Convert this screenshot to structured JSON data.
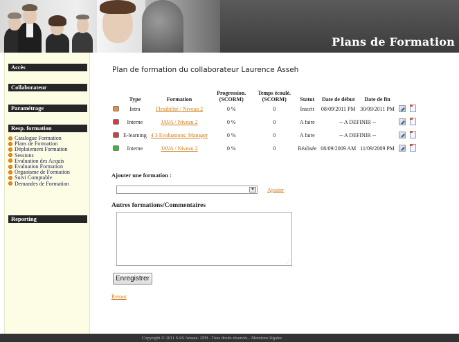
{
  "header": {
    "title": "Plans de Formation"
  },
  "sidebar": {
    "sections": {
      "acces": "Accès",
      "collaborateur": "Collaborateur",
      "parametrage": "Paramétrage",
      "resp_formation": "Resp. formation",
      "reporting": "Reporting"
    },
    "items": [
      "Catalogue Formation",
      "Plans de Formation",
      "Déploiement Formation",
      "Sessions",
      "Evaluation des Acquis",
      "Evaluation Formation",
      "Organisme de Formation",
      "Suivi Comptable",
      "Demandes de Formation"
    ]
  },
  "main": {
    "title": "Plan de formation du collaborateur Laurence Asseh",
    "columns": {
      "type": "Type",
      "formation": "Formation",
      "progression": "Progression. (SCORM)",
      "temps": "Temps écoulé. (SCORM)",
      "statut": "Statut",
      "date_debut": "Date de début",
      "date_fin": "Date de fin"
    },
    "rows": [
      {
        "color": "#e8903a",
        "type": "Intra",
        "formation": "Flexibilité / Niveau 2",
        "progression": "0 %",
        "temps": "0",
        "statut": "Inscrit",
        "date_debut": "08/09/2011 PM",
        "date_fin": "30/09/2011 PM",
        "to_define": ""
      },
      {
        "color": "#d83a3a",
        "type": "Interne",
        "formation": "JAVA / Niveau 2",
        "progression": "0 %",
        "temps": "0",
        "statut": "A faire",
        "date_debut": "",
        "date_fin": "",
        "to_define": "-- A DEFINIR --"
      },
      {
        "color": "#d83a3a",
        "type": "E-learning",
        "formation": "4 3 Evaluations: Manager",
        "progression": "0 %",
        "temps": "0",
        "statut": "A faire",
        "date_debut": "",
        "date_fin": "",
        "to_define": "-- A DEFINIR --"
      },
      {
        "color": "#3cba3c",
        "type": "Interne",
        "formation": "JAVA / Niveau 2",
        "progression": "0 %",
        "temps": "0",
        "statut": "Réalisée",
        "date_debut": "08/09/2009 AM",
        "date_fin": "11/09/2009 PM",
        "to_define": ""
      }
    ],
    "add_label": "Ajouter une formation :",
    "select_value": "",
    "add_link": "Ajouter",
    "comments_label": "Autres formations/Commentaires",
    "comments_value": "",
    "save_label": "Enregistrer",
    "back_link": "Retour"
  },
  "footer": {
    "text": "Copyright © 2011 SAS Amaze. 2PH - Tous droits réservés - Mentions légales"
  }
}
